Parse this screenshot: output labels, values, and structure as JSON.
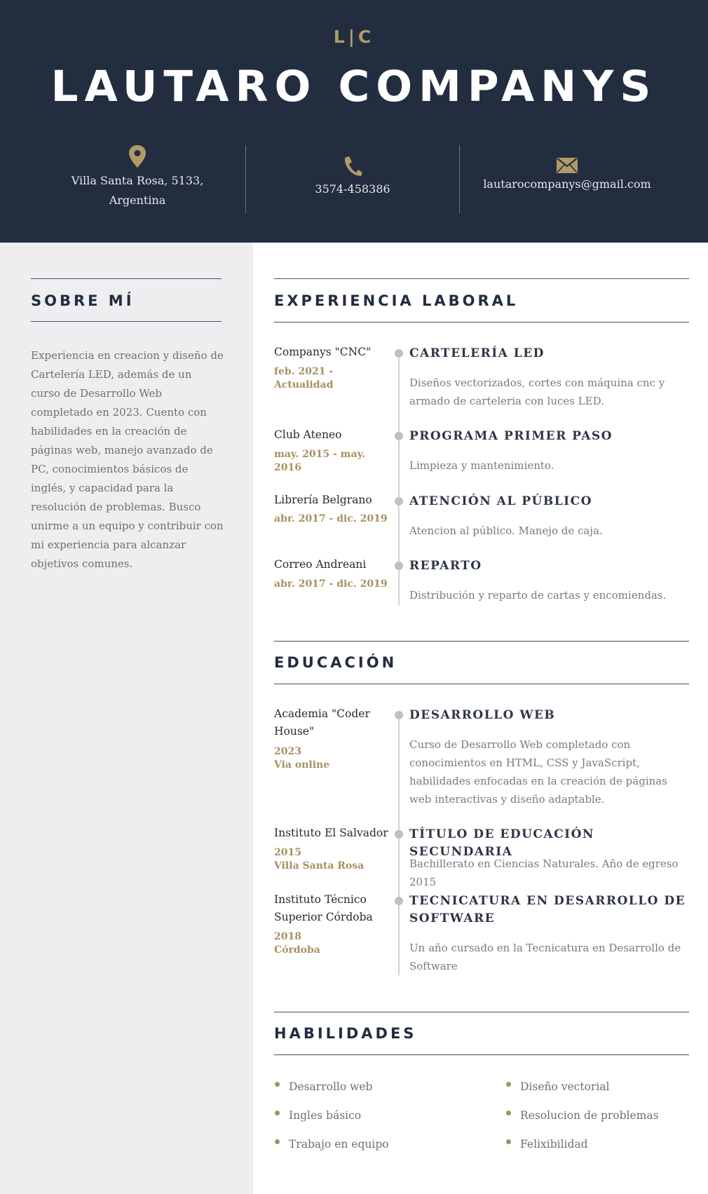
{
  "header": {
    "monogram": "L|C",
    "name": "LAUTARO COMPANYS",
    "contacts": [
      {
        "icon": "location-pin-icon",
        "line1": "Villa Santa Rosa, 5133,",
        "line2": "Argentina"
      },
      {
        "icon": "phone-icon",
        "text": "3574-458386"
      },
      {
        "icon": "envelope-icon",
        "text": "lautarocompanys@gmail.com"
      }
    ]
  },
  "about": {
    "title": "SOBRE MÍ",
    "text": "Experiencia en creacion y diseño de Cartelería LED, además de un curso de Desarrollo Web completado en 2023. Cuento con habilidades en la creación de páginas web, manejo avanzado de PC, conocimientos básicos de inglés, y capacidad para la resolución de problemas. Busco unirme a un equipo y contribuir con mi experiencia para alcanzar objetivos comunes."
  },
  "experience": {
    "title": "EXPERIENCIA LABORAL",
    "items": [
      {
        "org": "Companys \"CNC\"",
        "date": "feb. 2021 - Actualidad",
        "role": "CARTELERÍA LED",
        "desc": "Diseños vectorizados, cortes con máquina cnc y armado de carteleria con luces LED."
      },
      {
        "org": "Club Ateneo",
        "date": "may. 2015 - may. 2016",
        "role": "PROGRAMA PRIMER PASO",
        "desc": "Limpieza y mantenimiento."
      },
      {
        "org": "Librería Belgrano",
        "date": "abr. 2017 - dic. 2019",
        "role": "ATENCIÓN AL PÚBLICO",
        "desc": "Atencion al público. Manejo de caja."
      },
      {
        "org": "Correo Andreani",
        "date": "abr. 2017 - dic. 2019",
        "role": "REPARTO",
        "desc": "Distribución y reparto de cartas y encomiendas."
      }
    ]
  },
  "education": {
    "title": "EDUCACIÓN",
    "items": [
      {
        "org": "Academia \"Coder House\"",
        "date": "2023",
        "place": "Via online",
        "role": "DESARROLLO WEB",
        "desc": "Curso de Desarrollo Web completado con conocimientos en HTML, CSS y JavaScript, habilidades enfocadas en la creación de páginas web interactivas y diseño adaptable."
      },
      {
        "org": "Instituto El Salvador",
        "date": "2015",
        "place": "Villa Santa Rosa",
        "role": "TÍTULO DE EDUCACIÓN SECUNDARIA",
        "desc": "Bachillerato en Ciencias Naturales. Año de egreso 2015"
      },
      {
        "org": "Instituto Técnico Superior Córdoba",
        "date": "2018",
        "place": "Córdoba",
        "role": "TECNICATURA EN DESARROLLO DE SOFTWARE",
        "desc": "Un año cursado en la Tecnicatura en Desarrollo de Software"
      }
    ]
  },
  "skills": {
    "title": "HABILIDADES",
    "items": [
      "Desarrollo web",
      "Diseño vectorial",
      "Ingles básico",
      "Resolucion de problemas",
      "Trabajo en equipo",
      "Felixibilidad"
    ]
  }
}
